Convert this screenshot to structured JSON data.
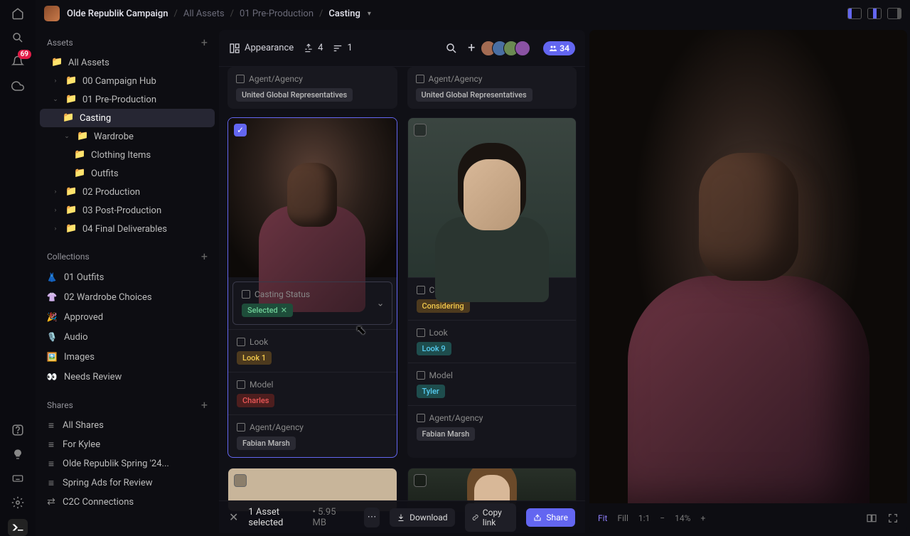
{
  "topbar": {
    "project": "Olde Republik Campaign",
    "crumbs": [
      "All Assets",
      "01 Pre-Production"
    ],
    "current": "Casting"
  },
  "rail": {
    "notification_count": "69"
  },
  "sidebar": {
    "assets_label": "Assets",
    "tree": {
      "all_assets": "All Assets",
      "campaign_hub": "00 Campaign Hub",
      "pre_prod": "01 Pre-Production",
      "casting": "Casting",
      "wardrobe": "Wardrobe",
      "clothing_items": "Clothing Items",
      "outfits": "Outfits",
      "production": "02 Production",
      "post": "03 Post-Production",
      "final": "04 Final Deliverables"
    },
    "collections_label": "Collections",
    "collections": {
      "outfits": "01 Outfits",
      "wardrobe_choices": "02 Wardrobe Choices",
      "approved": "Approved",
      "audio": "Audio",
      "images": "Images",
      "needs_review": "Needs Review"
    },
    "shares_label": "Shares",
    "shares": {
      "all": "All Shares",
      "kylee": "For Kylee",
      "spring": "Olde Republik Spring '24...",
      "ads": "Spring Ads for Review",
      "c2c": "C2C Connections"
    }
  },
  "content_header": {
    "appearance": "Appearance",
    "filter_count": "4",
    "sort_count": "1",
    "share_badge": "34"
  },
  "labels": {
    "agent": "Agent/Agency",
    "status": "Casting Status",
    "look": "Look",
    "model": "Model"
  },
  "prev_cards": [
    {
      "agency": "United Global Representatives"
    },
    {
      "agency": "United Global Representatives"
    }
  ],
  "cards": [
    {
      "status": "Selected",
      "look": "Look 1",
      "model": "Charles",
      "agency": "Fabian Marsh"
    },
    {
      "status": "Considering",
      "look": "Look 9",
      "model": "Tyler",
      "agency": "Fabian Marsh"
    }
  ],
  "bottom": {
    "selected": "1 Asset selected",
    "size": "5.95 MB",
    "download": "Download",
    "copy": "Copy link",
    "share": "Share"
  },
  "preview_ctrl": {
    "fit": "Fit",
    "fill": "Fill",
    "ratio": "1:1",
    "zoom": "14%"
  }
}
